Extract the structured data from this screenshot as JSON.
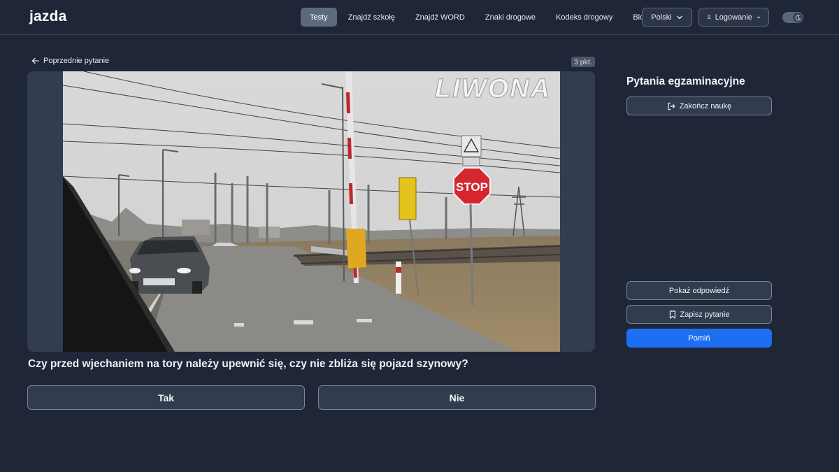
{
  "nav": {
    "logo": "jazda",
    "links": [
      "Testy",
      "Znajdź szkołę",
      "Znajdź WORD",
      "Znaki drogowe",
      "Kodeks drogowy",
      "Blog"
    ],
    "active_link": "Testy",
    "language": "Polski",
    "login": "Logowanie"
  },
  "main": {
    "back_label": "Poprzednie pytanie",
    "points": "3 pkt.",
    "image": {
      "watermark": "LIWONA",
      "stop_sign": "STOP"
    },
    "question": "Czy przed wjechaniem na tory należy upewnić się, czy nie zbliża się pojazd szynowy?",
    "answers": [
      "Tak",
      "Nie"
    ]
  },
  "sidebar": {
    "title": "Pytania egzaminacyjne",
    "end_label": "Zakończ naukę",
    "show_answer_label": "Pokaż odpowiedź",
    "save_label": "Zapisz pytanie",
    "skip_label": "Pomiń"
  },
  "colors": {
    "background": "#1e2638",
    "accent": "#1d6ff2",
    "active_nav": "#5c6a80"
  }
}
